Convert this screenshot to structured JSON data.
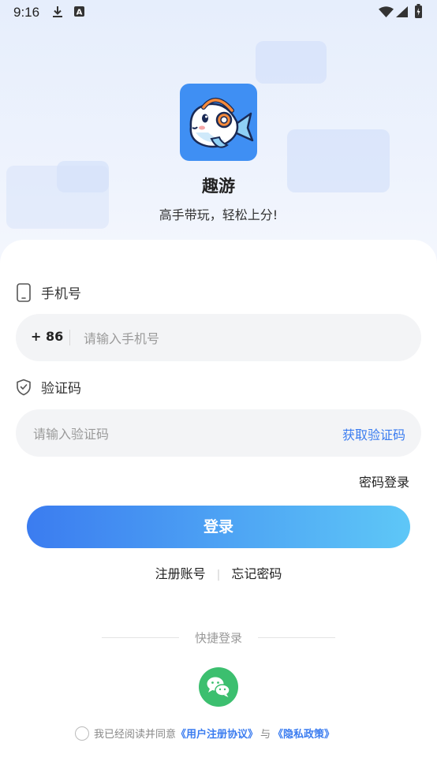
{
  "status_bar": {
    "time": "9:16",
    "left_icons": [
      "download-icon",
      "accessibility-a-icon"
    ],
    "right_icons": [
      "wifi-icon",
      "signal-icon",
      "battery-icon"
    ]
  },
  "app": {
    "name": "趣游",
    "slogan": "高手带玩，轻松上分!",
    "logo_icon": "fish-headphones-logo",
    "brand_color": "#3f8ff3"
  },
  "form": {
    "phone_label": "手机号",
    "phone_icon": "phone-icon",
    "country_code": "+ 86",
    "phone_placeholder": "请输入手机号",
    "code_label": "验证码",
    "code_icon": "shield-check-icon",
    "code_placeholder": "请输入验证码",
    "get_code_label": "获取验证码",
    "password_login_label": "密码登录",
    "login_button_label": "登录",
    "register_label": "注册账号",
    "links_separator": "|",
    "forgot_password_label": "忘记密码"
  },
  "quick_login": {
    "label": "快捷登录",
    "wechat_icon": "wechat-icon"
  },
  "agreement": {
    "prefix": "我已经阅读并同意",
    "user_agreement": "《用户注册协议》",
    "conjunction": "与",
    "privacy_policy": "《隐私政策》",
    "checked": false
  },
  "colors": {
    "accent": "#3a7cf0",
    "button_gradient_start": "#3b7cf0",
    "button_gradient_end": "#5ec7f7",
    "wechat_green": "#3cbf6f"
  }
}
